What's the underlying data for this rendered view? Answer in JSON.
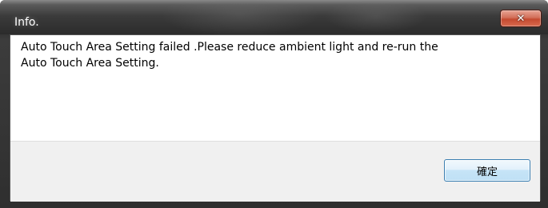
{
  "window": {
    "title": "Info.",
    "close_glyph": "✕"
  },
  "dialog": {
    "message": "Auto Touch Area Setting failed .Please reduce ambient light and re-run the\nAuto Touch Area Setting.",
    "ok_label": "確定"
  },
  "icons": {
    "close": "close-icon"
  }
}
